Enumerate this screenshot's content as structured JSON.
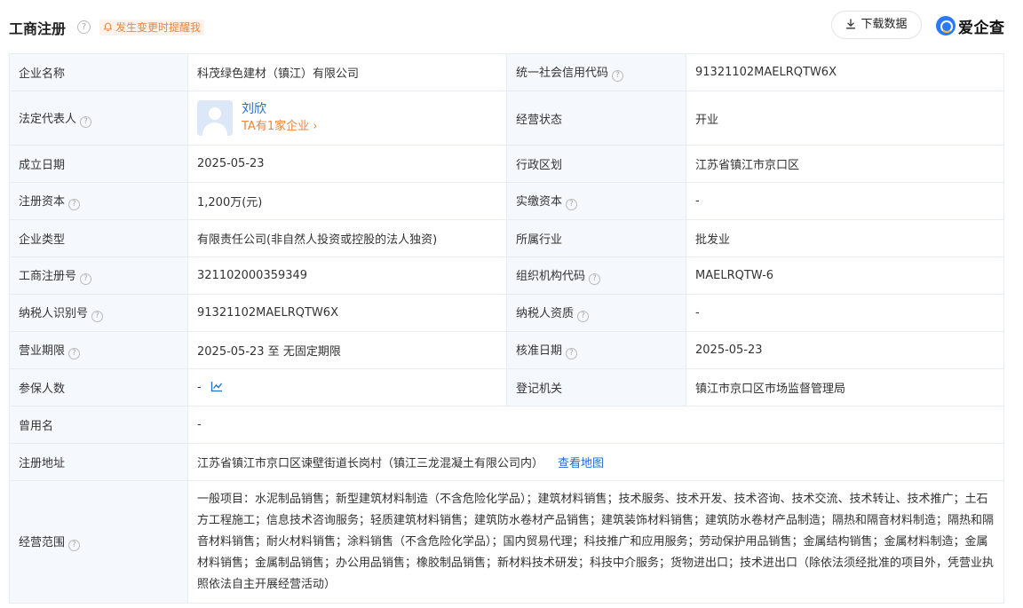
{
  "header": {
    "title": "工商注册",
    "alert_label": "发生变更时提醒我",
    "download_label": "下载数据",
    "brand": "爱企查"
  },
  "rows": {
    "r1": {
      "l1": "企业名称",
      "v1": "科茂绿色建材（镇江）有限公司",
      "l2": "统一社会信用代码",
      "v2": "91321102MAELRQTW6X"
    },
    "r2": {
      "l1": "法定代表人",
      "rep_name": "刘欣",
      "rep_sub": "TA有1家企业",
      "l2": "经营状态",
      "v2": "开业"
    },
    "r3": {
      "l1": "成立日期",
      "v1": "2025-05-23",
      "l2": "行政区划",
      "v2": "江苏省镇江市京口区"
    },
    "r4": {
      "l1": "注册资本",
      "v1": "1,200万(元)",
      "l2": "实缴资本",
      "v2": "-"
    },
    "r5": {
      "l1": "企业类型",
      "v1": "有限责任公司(非自然人投资或控股的法人独资)",
      "l2": "所属行业",
      "v2": "批发业"
    },
    "r6": {
      "l1": "工商注册号",
      "v1": "321102000359349",
      "l2": "组织机构代码",
      "v2": "MAELRQTW-6"
    },
    "r7": {
      "l1": "纳税人识别号",
      "v1": "91321102MAELRQTW6X",
      "l2": "纳税人资质",
      "v2": "-"
    },
    "r8": {
      "l1": "营业期限",
      "v1": "2025-05-23 至 无固定期限",
      "l2": "核准日期",
      "v2": "2025-05-23"
    },
    "r9": {
      "l1": "参保人数",
      "v1": "-",
      "l2": "登记机关",
      "v2": "镇江市京口区市场监督管理局"
    },
    "r10": {
      "l1": "曾用名",
      "v1": "-"
    },
    "r11": {
      "l1": "注册地址",
      "v1": "江苏省镇江市京口区谏壁街道长岗村（镇江三龙混凝土有限公司内）",
      "map_link": "查看地图"
    },
    "r12": {
      "l1": "经营范围",
      "v1": "一般项目：水泥制品销售；新型建筑材料制造（不含危险化学品）；建筑材料销售；技术服务、技术开发、技术咨询、技术交流、技术转让、技术推广；土石方工程施工；信息技术咨询服务；轻质建筑材料销售；建筑防水卷材产品销售；建筑装饰材料销售；建筑防水卷材产品制造；隔热和隔音材料制造；隔热和隔音材料销售；耐火材料销售；涂料销售（不含危险化学品）；国内贸易代理；科技推广和应用服务；劳动保护用品销售；金属结构销售；金属材料制造；金属材料销售；金属制品销售；办公用品销售；橡胶制品销售；新材料技术研发；科技中介服务；货物进出口；技术进出口（除依法须经批准的项目外，凭营业执照依法自主开展经营活动）"
    }
  },
  "colors": {
    "accent": "#1a6ed8",
    "alert": "#f0843c",
    "label_bg": "#f5f8fd",
    "border": "#e9ecf3"
  }
}
